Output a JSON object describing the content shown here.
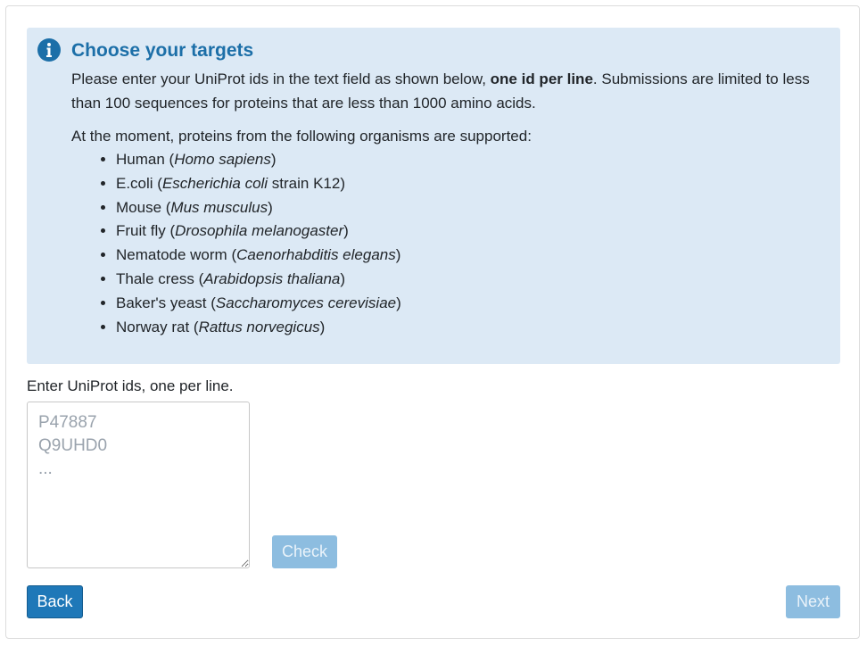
{
  "info": {
    "title": "Choose your targets",
    "text_before_bold": "Please enter your UniProt ids in the text field as shown below, ",
    "text_bold": "one id per line",
    "text_after_bold": ". Submissions are limited to less than 100 sequences for proteins that are less than 1000 amino acids.",
    "organisms_intro": "At the moment, proteins from the following organisms are supported:",
    "organisms": [
      {
        "common": "Human",
        "scientific": "Homo sapiens",
        "suffix": ""
      },
      {
        "common": "E.coli",
        "scientific": "Escherichia coli",
        "suffix": " strain K12"
      },
      {
        "common": "Mouse",
        "scientific": "Mus musculus",
        "suffix": ""
      },
      {
        "common": "Fruit fly",
        "scientific": "Drosophila melanogaster",
        "suffix": ""
      },
      {
        "common": "Nematode worm",
        "scientific": "Caenorhabditis elegans",
        "suffix": ""
      },
      {
        "common": "Thale cress",
        "scientific": "Arabidopsis thaliana",
        "suffix": ""
      },
      {
        "common": "Baker's yeast",
        "scientific": "Saccharomyces cerevisiae",
        "suffix": ""
      },
      {
        "common": "Norway rat",
        "scientific": "Rattus norvegicus",
        "suffix": ""
      }
    ],
    "icon": "info-icon"
  },
  "form": {
    "input_label": "Enter UniProt ids, one per line.",
    "textarea_placeholder": "P47887\nQ9UHD0\n...",
    "textarea_value": "",
    "check_label": "Check",
    "back_label": "Back",
    "next_label": "Next"
  },
  "colors": {
    "info_bg": "#dce9f5",
    "title_color": "#1c6fa8",
    "primary": "#1f78b8",
    "disabled": "#8dbde0"
  }
}
